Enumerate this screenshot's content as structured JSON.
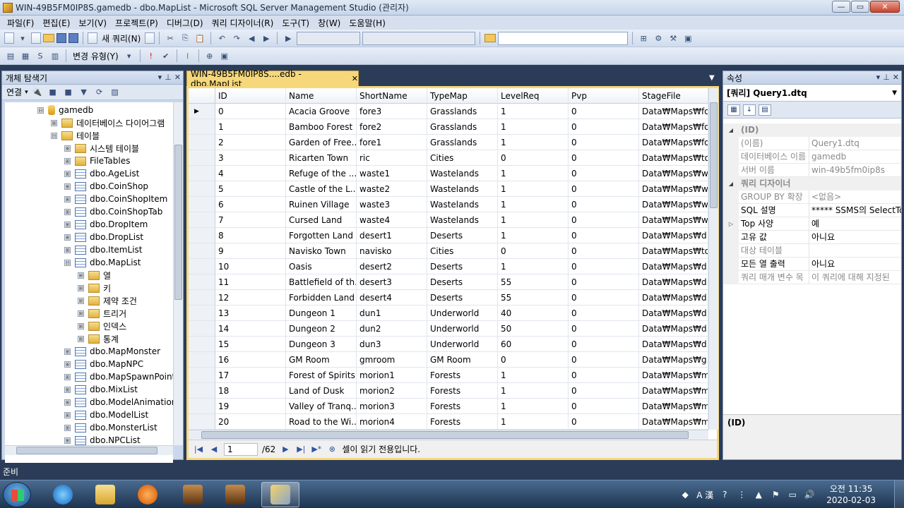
{
  "window": {
    "title": "WIN-49B5FM0IP8S.gamedb - dbo.MapList - Microsoft SQL Server Management Studio (관리자)",
    "min": "—",
    "max": "▭",
    "close": "✕"
  },
  "menu": [
    "파일(F)",
    "편집(E)",
    "보기(V)",
    "프로젝트(P)",
    "디버그(D)",
    "쿼리 디자이너(R)",
    "도구(T)",
    "창(W)",
    "도움말(H)"
  ],
  "toolbar": {
    "new_query": "새 쿼리(N)",
    "change_type": "변경 유형(Y)"
  },
  "object_explorer": {
    "title": "개체 탐색기",
    "connect": "연결",
    "tree": [
      {
        "label": "gamedb",
        "exp": "⊟",
        "icon": "database-icon",
        "indent": 0
      },
      {
        "label": "데이터베이스 다이어그램",
        "exp": "⊞",
        "icon": "folder-icon",
        "indent": 1
      },
      {
        "label": "테이블",
        "exp": "⊟",
        "icon": "folder-icon",
        "indent": 1
      },
      {
        "label": "시스템 테이블",
        "exp": "⊞",
        "icon": "folder-icon",
        "indent": 2
      },
      {
        "label": "FileTables",
        "exp": "⊞",
        "icon": "folder-icon",
        "indent": 2
      },
      {
        "label": "dbo.AgeList",
        "exp": "⊞",
        "icon": "table-icon",
        "indent": 2
      },
      {
        "label": "dbo.CoinShop",
        "exp": "⊞",
        "icon": "table-icon",
        "indent": 2
      },
      {
        "label": "dbo.CoinShopItem",
        "exp": "⊞",
        "icon": "table-icon",
        "indent": 2
      },
      {
        "label": "dbo.CoinShopTab",
        "exp": "⊞",
        "icon": "table-icon",
        "indent": 2
      },
      {
        "label": "dbo.DropItem",
        "exp": "⊞",
        "icon": "table-icon",
        "indent": 2
      },
      {
        "label": "dbo.DropList",
        "exp": "⊞",
        "icon": "table-icon",
        "indent": 2
      },
      {
        "label": "dbo.ItemList",
        "exp": "⊞",
        "icon": "table-icon",
        "indent": 2
      },
      {
        "label": "dbo.MapList",
        "exp": "⊟",
        "icon": "table-icon",
        "indent": 2
      },
      {
        "label": "열",
        "exp": "⊞",
        "icon": "folder-icon",
        "indent": 3
      },
      {
        "label": "키",
        "exp": "⊞",
        "icon": "folder-icon",
        "indent": 3
      },
      {
        "label": "제약 조건",
        "exp": "⊞",
        "icon": "folder-icon",
        "indent": 3
      },
      {
        "label": "트리거",
        "exp": "⊞",
        "icon": "folder-icon",
        "indent": 3
      },
      {
        "label": "인덱스",
        "exp": "⊞",
        "icon": "folder-icon",
        "indent": 3
      },
      {
        "label": "통계",
        "exp": "⊞",
        "icon": "folder-icon",
        "indent": 3
      },
      {
        "label": "dbo.MapMonster",
        "exp": "⊞",
        "icon": "table-icon",
        "indent": 2
      },
      {
        "label": "dbo.MapNPC",
        "exp": "⊞",
        "icon": "table-icon",
        "indent": 2
      },
      {
        "label": "dbo.MapSpawnPoint",
        "exp": "⊞",
        "icon": "table-icon",
        "indent": 2
      },
      {
        "label": "dbo.MixList",
        "exp": "⊞",
        "icon": "table-icon",
        "indent": 2
      },
      {
        "label": "dbo.ModelAnimation",
        "exp": "⊞",
        "icon": "table-icon",
        "indent": 2
      },
      {
        "label": "dbo.ModelList",
        "exp": "⊞",
        "icon": "table-icon",
        "indent": 2
      },
      {
        "label": "dbo.MonsterList",
        "exp": "⊞",
        "icon": "table-icon",
        "indent": 2
      },
      {
        "label": "dbo.NPCList",
        "exp": "⊞",
        "icon": "table-icon",
        "indent": 2
      }
    ]
  },
  "document": {
    "tab_label": "WIN-49B5FM0IP8S....edb - dbo.MapList",
    "tab_close": "✕",
    "columns": [
      "ID",
      "Name",
      "ShortName",
      "TypeMap",
      "LevelReq",
      "Pvp",
      "StageFile"
    ],
    "rows": [
      [
        "0",
        "Acacia Groove",
        "fore3",
        "Grasslands",
        "1",
        "0",
        "Data₩Maps₩fo..."
      ],
      [
        "1",
        "Bamboo Forest",
        "fore2",
        "Grasslands",
        "1",
        "0",
        "Data₩Maps₩fo..."
      ],
      [
        "2",
        "Garden of Free...",
        "fore1",
        "Grasslands",
        "1",
        "0",
        "Data₩Maps₩fo..."
      ],
      [
        "3",
        "Ricarten Town",
        "ric",
        "Cities",
        "0",
        "0",
        "Data₩Maps₩to..."
      ],
      [
        "4",
        "Refuge of the ...",
        "waste1",
        "Wastelands",
        "1",
        "0",
        "Data₩Maps₩w..."
      ],
      [
        "5",
        "Castle of the L...",
        "waste2",
        "Wastelands",
        "1",
        "0",
        "Data₩Maps₩w..."
      ],
      [
        "6",
        "Ruinen Village",
        "waste3",
        "Wastelands",
        "1",
        "0",
        "Data₩Maps₩w..."
      ],
      [
        "7",
        "Cursed Land",
        "waste4",
        "Wastelands",
        "1",
        "0",
        "Data₩Maps₩w..."
      ],
      [
        "8",
        "Forgotten Land",
        "desert1",
        "Deserts",
        "1",
        "0",
        "Data₩Maps₩d..."
      ],
      [
        "9",
        "Navisko Town",
        "navisko",
        "Cities",
        "0",
        "0",
        "Data₩Maps₩to..."
      ],
      [
        "10",
        "Oasis",
        "desert2",
        "Deserts",
        "1",
        "0",
        "Data₩Maps₩d..."
      ],
      [
        "11",
        "Battlefield of th...",
        "desert3",
        "Deserts",
        "55",
        "0",
        "Data₩Maps₩d..."
      ],
      [
        "12",
        "Forbidden Land",
        "desert4",
        "Deserts",
        "55",
        "0",
        "Data₩Maps₩d..."
      ],
      [
        "13",
        "Dungeon 1",
        "dun1",
        "Underworld",
        "40",
        "0",
        "Data₩Maps₩d..."
      ],
      [
        "14",
        "Dungeon 2",
        "dun2",
        "Underworld",
        "50",
        "0",
        "Data₩Maps₩d..."
      ],
      [
        "15",
        "Dungeon 3",
        "dun3",
        "Underworld",
        "60",
        "0",
        "Data₩Maps₩d..."
      ],
      [
        "16",
        "GM Room",
        "gmroom",
        "GM Room",
        "0",
        "0",
        "Data₩Maps₩g..."
      ],
      [
        "17",
        "Forest of Spirits",
        "morion1",
        "Forests",
        "1",
        "0",
        "Data₩Maps₩m..."
      ],
      [
        "18",
        "Land of Dusk",
        "morion2",
        "Forests",
        "1",
        "0",
        "Data₩Maps₩m..."
      ],
      [
        "19",
        "Valley of Tranq...",
        "morion3",
        "Forests",
        "1",
        "0",
        "Data₩Maps₩m..."
      ],
      [
        "20",
        "Road to the Wi...",
        "morion4",
        "Forests",
        "1",
        "0",
        "Data₩Maps₩m..."
      ]
    ],
    "nav": {
      "current": "1",
      "total": "/62",
      "status": "셀이 읽기 전용입니다."
    }
  },
  "properties": {
    "title": "속성",
    "object": "[쿼리] Query1.dtq",
    "rows": [
      {
        "type": "cat",
        "label": "(ID)",
        "gut": "◢"
      },
      {
        "type": "prop",
        "key": "(이름)",
        "value": "Query1.dtq",
        "gray": true
      },
      {
        "type": "prop",
        "key": "데이터베이스 이름",
        "value": "gamedb",
        "gray": true
      },
      {
        "type": "prop",
        "key": "서버 이름",
        "value": "win-49b5fm0ip8s",
        "gray": true
      },
      {
        "type": "cat",
        "label": "쿼리 디자이너",
        "gut": "◢"
      },
      {
        "type": "prop",
        "key": "GROUP BY 확장",
        "value": "<없음>",
        "gray": true
      },
      {
        "type": "prop",
        "key": "SQL 설명",
        "value": "***** SSMS의 SelectTop",
        "gray": false
      },
      {
        "type": "prop",
        "key": "Top 사양",
        "value": "예",
        "gray": false,
        "gut": "▷"
      },
      {
        "type": "prop",
        "key": "고유 값",
        "value": "아니요",
        "gray": false
      },
      {
        "type": "prop",
        "key": "대상 테이블",
        "value": "",
        "gray": true
      },
      {
        "type": "prop",
        "key": "모든 열 출력",
        "value": "아니요",
        "gray": false
      },
      {
        "type": "prop",
        "key": "쿼리 매개 변수 목",
        "value": "이 쿼리에 대해 지정된",
        "gray": true
      }
    ],
    "description": "(ID)"
  },
  "status": {
    "text": "준비"
  },
  "taskbar": {
    "ime": "A 漢",
    "time": "오전 11:35",
    "date": "2020-02-03"
  }
}
